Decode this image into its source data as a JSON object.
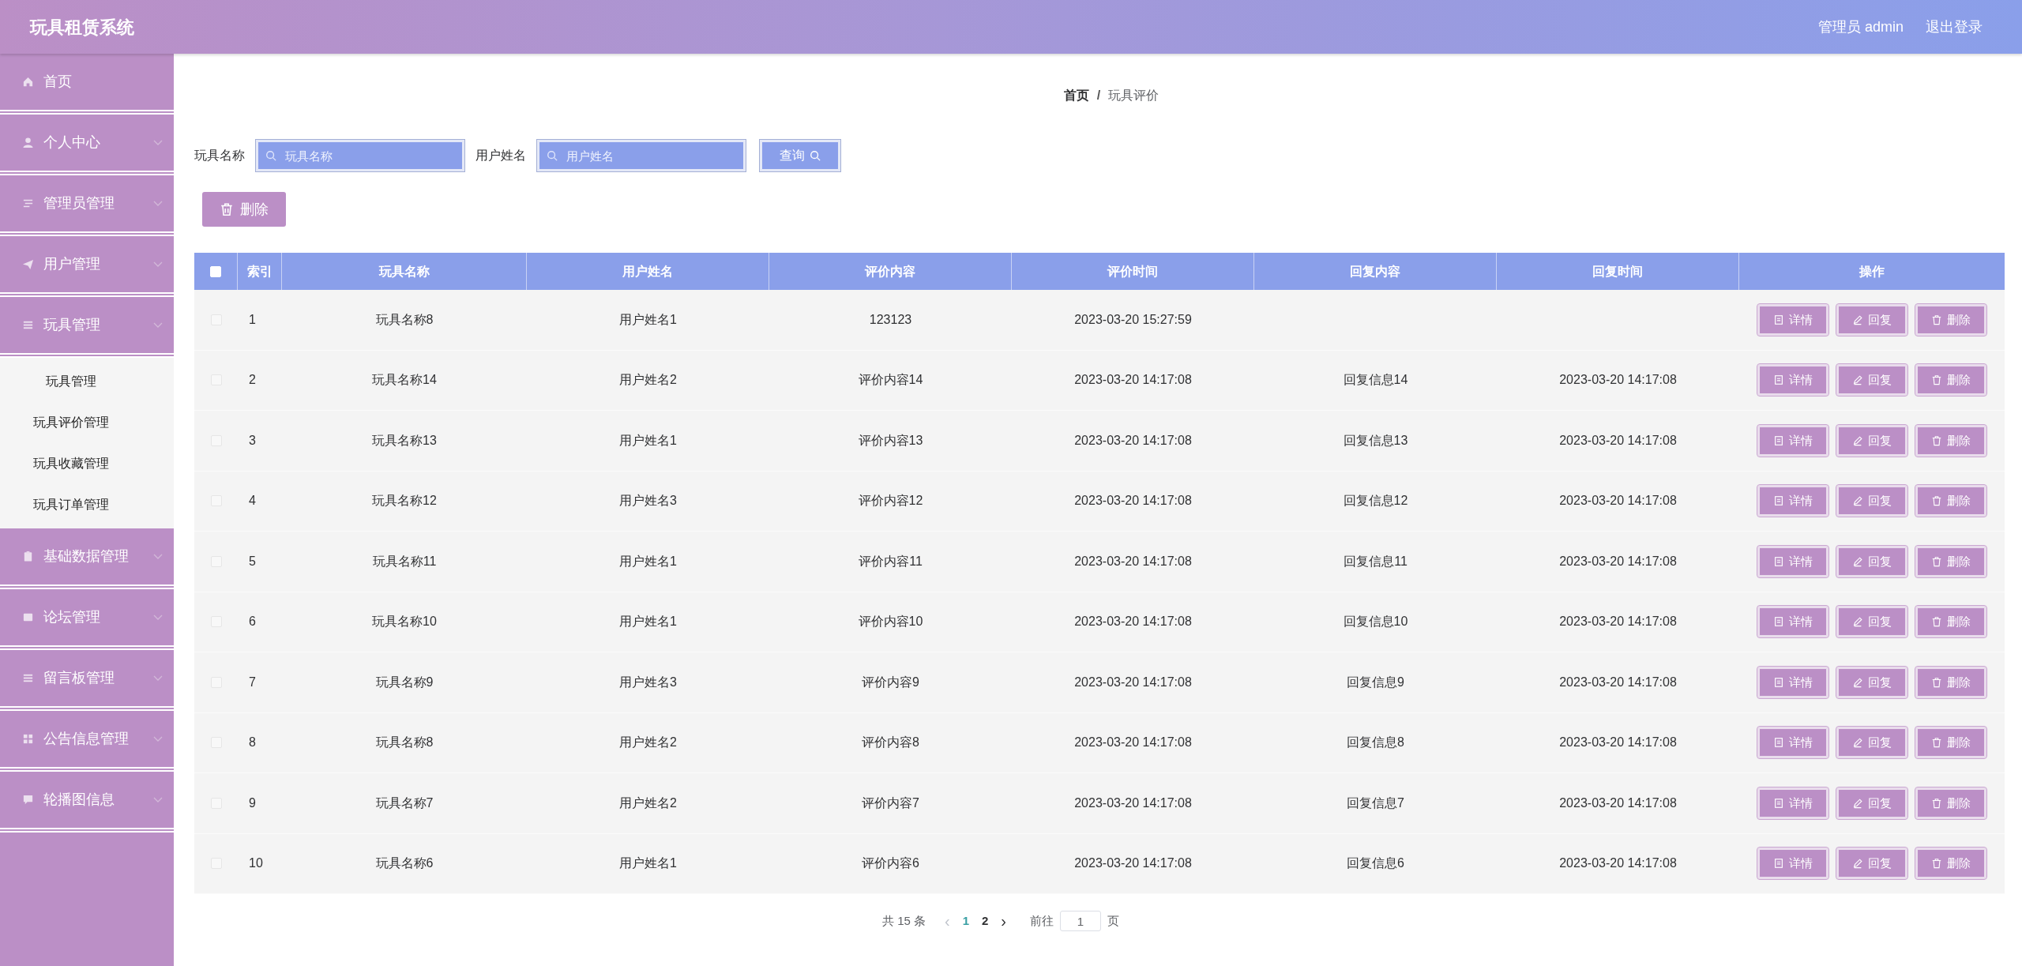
{
  "header": {
    "title": "玩具租赁系统",
    "user": "管理员 admin",
    "logout": "退出登录"
  },
  "sidebar": {
    "items": [
      {
        "label": "首页",
        "kind": "link"
      },
      {
        "label": "个人中心",
        "kind": "menu"
      },
      {
        "label": "管理员管理",
        "kind": "menu"
      },
      {
        "label": "用户管理",
        "kind": "menu"
      },
      {
        "label": "玩具管理",
        "kind": "menu",
        "children": [
          {
            "label": "玩具管理"
          },
          {
            "label": "玩具评价管理"
          },
          {
            "label": "玩具收藏管理"
          },
          {
            "label": "玩具订单管理"
          }
        ]
      },
      {
        "label": "基础数据管理",
        "kind": "menu"
      },
      {
        "label": "论坛管理",
        "kind": "menu"
      },
      {
        "label": "留言板管理",
        "kind": "menu"
      },
      {
        "label": "公告信息管理",
        "kind": "menu"
      },
      {
        "label": "轮播图信息",
        "kind": "menu"
      }
    ]
  },
  "breadcrumb": {
    "items": [
      "首页",
      "玩具评价"
    ],
    "separator": "/"
  },
  "search": {
    "fields": [
      {
        "label": "玩具名称",
        "placeholder": "玩具名称"
      },
      {
        "label": "用户姓名",
        "placeholder": "用户姓名"
      }
    ],
    "button": "查询"
  },
  "delete_button": "删除",
  "table": {
    "header_checked": false,
    "columns": [
      "索引",
      "玩具名称",
      "用户姓名",
      "评价内容",
      "评价时间",
      "回复内容",
      "回复时间",
      "操作"
    ],
    "rows": [
      {
        "checked": false,
        "cells": [
          "1",
          "玩具名称8",
          "用户姓名1",
          "123123",
          "2023-03-20 15:27:59",
          "",
          ""
        ],
        "actions": [
          "详情",
          "回复",
          "删除"
        ]
      },
      {
        "checked": false,
        "cells": [
          "2",
          "玩具名称14",
          "用户姓名2",
          "评价内容14",
          "2023-03-20 14:17:08",
          "回复信息14",
          "2023-03-20 14:17:08"
        ],
        "actions": [
          "详情",
          "回复",
          "删除"
        ]
      },
      {
        "checked": false,
        "cells": [
          "3",
          "玩具名称13",
          "用户姓名1",
          "评价内容13",
          "2023-03-20 14:17:08",
          "回复信息13",
          "2023-03-20 14:17:08"
        ],
        "actions": [
          "详情",
          "回复",
          "删除"
        ]
      },
      {
        "checked": false,
        "cells": [
          "4",
          "玩具名称12",
          "用户姓名3",
          "评价内容12",
          "2023-03-20 14:17:08",
          "回复信息12",
          "2023-03-20 14:17:08"
        ],
        "actions": [
          "详情",
          "回复",
          "删除"
        ]
      },
      {
        "checked": false,
        "cells": [
          "5",
          "玩具名称11",
          "用户姓名1",
          "评价内容11",
          "2023-03-20 14:17:08",
          "回复信息11",
          "2023-03-20 14:17:08"
        ],
        "actions": [
          "详情",
          "回复",
          "删除"
        ]
      },
      {
        "checked": false,
        "cells": [
          "6",
          "玩具名称10",
          "用户姓名1",
          "评价内容10",
          "2023-03-20 14:17:08",
          "回复信息10",
          "2023-03-20 14:17:08"
        ],
        "actions": [
          "详情",
          "回复",
          "删除"
        ]
      },
      {
        "checked": false,
        "cells": [
          "7",
          "玩具名称9",
          "用户姓名3",
          "评价内容9",
          "2023-03-20 14:17:08",
          "回复信息9",
          "2023-03-20 14:17:08"
        ],
        "actions": [
          "详情",
          "回复",
          "删除"
        ]
      },
      {
        "checked": false,
        "cells": [
          "8",
          "玩具名称8",
          "用户姓名2",
          "评价内容8",
          "2023-03-20 14:17:08",
          "回复信息8",
          "2023-03-20 14:17:08"
        ],
        "actions": [
          "详情",
          "回复",
          "删除"
        ]
      },
      {
        "checked": false,
        "cells": [
          "9",
          "玩具名称7",
          "用户姓名2",
          "评价内容7",
          "2023-03-20 14:17:08",
          "回复信息7",
          "2023-03-20 14:17:08"
        ],
        "actions": [
          "详情",
          "回复",
          "删除"
        ]
      },
      {
        "checked": false,
        "cells": [
          "10",
          "玩具名称6",
          "用户姓名1",
          "评价内容6",
          "2023-03-20 14:17:08",
          "回复信息6",
          "2023-03-20 14:17:08"
        ],
        "actions": [
          "详情",
          "回复",
          "删除"
        ]
      }
    ]
  },
  "pagination": {
    "total": "共 15 条",
    "prev": "‹",
    "pages": [
      {
        "label": "1",
        "selected": true
      },
      {
        "label": "2",
        "selected": false
      }
    ],
    "next": "›",
    "goto": "前往",
    "page_value": "1",
    "page_suffix": "页"
  }
}
